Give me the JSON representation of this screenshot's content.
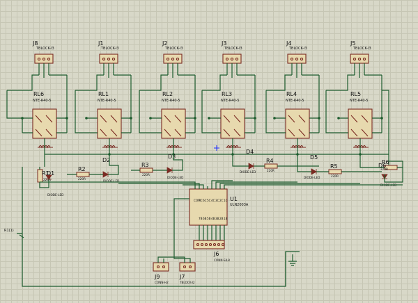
{
  "relays": [
    {
      "conn_ref": "J8",
      "conn_type": "TBLOCK-I3",
      "ref": "RL6",
      "type": "NTE-R40-5"
    },
    {
      "conn_ref": "J1",
      "conn_type": "TBLOCK-I3",
      "ref": "RL1",
      "type": "NTE-R40-5"
    },
    {
      "conn_ref": "J2",
      "conn_type": "TBLOCK-I3",
      "ref": "RL2",
      "type": "NTE-R40-5"
    },
    {
      "conn_ref": "J3",
      "conn_type": "TBLOCK-I3",
      "ref": "RL3",
      "type": "NTE-R40-5"
    },
    {
      "conn_ref": "J4",
      "conn_type": "TBLOCK-I3",
      "ref": "RL4",
      "type": "NTE-R40-5"
    },
    {
      "conn_ref": "J5",
      "conn_type": "TBLOCK-I3",
      "ref": "RL5",
      "type": "NTE-R40-5"
    }
  ],
  "resistors": [
    {
      "ref": "R1",
      "value": "220R"
    },
    {
      "ref": "R2",
      "value": "220R"
    },
    {
      "ref": "R3",
      "value": "220R"
    },
    {
      "ref": "R4",
      "value": "220R"
    },
    {
      "ref": "R5",
      "value": "220R"
    },
    {
      "ref": "R6",
      "value": "220R"
    }
  ],
  "leds": [
    {
      "ref": "D1",
      "type": "DIODE-LED"
    },
    {
      "ref": "D2",
      "type": "DIODE-LED"
    },
    {
      "ref": "D3",
      "type": "DIODE-LED"
    },
    {
      "ref": "D4",
      "type": "DIODE-LED"
    },
    {
      "ref": "D5",
      "type": "DIODE-LED"
    },
    {
      "ref": "D6",
      "type": "DIODE-LED"
    }
  ],
  "driver": {
    "ref": "U1",
    "type": "ULN2003A",
    "top_pins": [
      "COM",
      "7C",
      "6C",
      "5C",
      "4C",
      "3C",
      "2C",
      "1C"
    ],
    "bottom_pins": [
      "7B",
      "6B",
      "5B",
      "4B",
      "3B",
      "2B",
      "1B"
    ]
  },
  "j6": {
    "ref": "J6",
    "type": "CONN-SIL8"
  },
  "j9": {
    "ref": "J9",
    "type": "CONN-H2"
  },
  "j7": {
    "ref": "J7",
    "type": "TBLOCK-I2"
  },
  "net_label": "R1(1)",
  "colors": {
    "wire": "#1d5c2e",
    "part": "#7a2a22",
    "fill": "#e7d9ae",
    "grid": "#d8d8c8"
  }
}
